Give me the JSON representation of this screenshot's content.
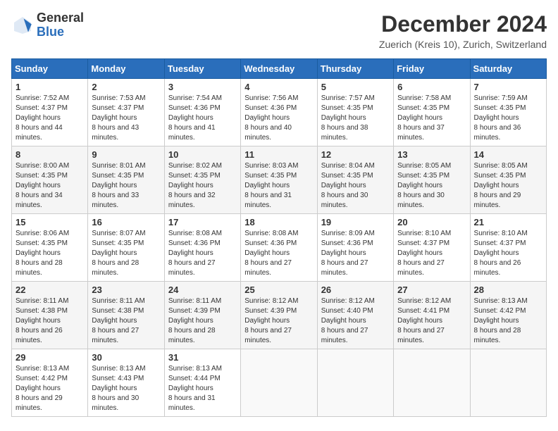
{
  "logo": {
    "general": "General",
    "blue": "Blue"
  },
  "title": "December 2024",
  "subtitle": "Zuerich (Kreis 10), Zurich, Switzerland",
  "weekdays": [
    "Sunday",
    "Monday",
    "Tuesday",
    "Wednesday",
    "Thursday",
    "Friday",
    "Saturday"
  ],
  "weeks": [
    [
      {
        "day": 1,
        "sunrise": "7:52 AM",
        "sunset": "4:37 PM",
        "daylight": "8 hours and 44 minutes."
      },
      {
        "day": 2,
        "sunrise": "7:53 AM",
        "sunset": "4:37 PM",
        "daylight": "8 hours and 43 minutes."
      },
      {
        "day": 3,
        "sunrise": "7:54 AM",
        "sunset": "4:36 PM",
        "daylight": "8 hours and 41 minutes."
      },
      {
        "day": 4,
        "sunrise": "7:56 AM",
        "sunset": "4:36 PM",
        "daylight": "8 hours and 40 minutes."
      },
      {
        "day": 5,
        "sunrise": "7:57 AM",
        "sunset": "4:35 PM",
        "daylight": "8 hours and 38 minutes."
      },
      {
        "day": 6,
        "sunrise": "7:58 AM",
        "sunset": "4:35 PM",
        "daylight": "8 hours and 37 minutes."
      },
      {
        "day": 7,
        "sunrise": "7:59 AM",
        "sunset": "4:35 PM",
        "daylight": "8 hours and 36 minutes."
      }
    ],
    [
      {
        "day": 8,
        "sunrise": "8:00 AM",
        "sunset": "4:35 PM",
        "daylight": "8 hours and 34 minutes."
      },
      {
        "day": 9,
        "sunrise": "8:01 AM",
        "sunset": "4:35 PM",
        "daylight": "8 hours and 33 minutes."
      },
      {
        "day": 10,
        "sunrise": "8:02 AM",
        "sunset": "4:35 PM",
        "daylight": "8 hours and 32 minutes."
      },
      {
        "day": 11,
        "sunrise": "8:03 AM",
        "sunset": "4:35 PM",
        "daylight": "8 hours and 31 minutes."
      },
      {
        "day": 12,
        "sunrise": "8:04 AM",
        "sunset": "4:35 PM",
        "daylight": "8 hours and 30 minutes."
      },
      {
        "day": 13,
        "sunrise": "8:05 AM",
        "sunset": "4:35 PM",
        "daylight": "8 hours and 30 minutes."
      },
      {
        "day": 14,
        "sunrise": "8:05 AM",
        "sunset": "4:35 PM",
        "daylight": "8 hours and 29 minutes."
      }
    ],
    [
      {
        "day": 15,
        "sunrise": "8:06 AM",
        "sunset": "4:35 PM",
        "daylight": "8 hours and 28 minutes."
      },
      {
        "day": 16,
        "sunrise": "8:07 AM",
        "sunset": "4:35 PM",
        "daylight": "8 hours and 28 minutes."
      },
      {
        "day": 17,
        "sunrise": "8:08 AM",
        "sunset": "4:36 PM",
        "daylight": "8 hours and 27 minutes."
      },
      {
        "day": 18,
        "sunrise": "8:08 AM",
        "sunset": "4:36 PM",
        "daylight": "8 hours and 27 minutes."
      },
      {
        "day": 19,
        "sunrise": "8:09 AM",
        "sunset": "4:36 PM",
        "daylight": "8 hours and 27 minutes."
      },
      {
        "day": 20,
        "sunrise": "8:10 AM",
        "sunset": "4:37 PM",
        "daylight": "8 hours and 27 minutes."
      },
      {
        "day": 21,
        "sunrise": "8:10 AM",
        "sunset": "4:37 PM",
        "daylight": "8 hours and 26 minutes."
      }
    ],
    [
      {
        "day": 22,
        "sunrise": "8:11 AM",
        "sunset": "4:38 PM",
        "daylight": "8 hours and 26 minutes."
      },
      {
        "day": 23,
        "sunrise": "8:11 AM",
        "sunset": "4:38 PM",
        "daylight": "8 hours and 27 minutes."
      },
      {
        "day": 24,
        "sunrise": "8:11 AM",
        "sunset": "4:39 PM",
        "daylight": "8 hours and 28 minutes."
      },
      {
        "day": 25,
        "sunrise": "8:12 AM",
        "sunset": "4:39 PM",
        "daylight": "8 hours and 27 minutes."
      },
      {
        "day": 26,
        "sunrise": "8:12 AM",
        "sunset": "4:40 PM",
        "daylight": "8 hours and 27 minutes."
      },
      {
        "day": 27,
        "sunrise": "8:12 AM",
        "sunset": "4:41 PM",
        "daylight": "8 hours and 27 minutes."
      },
      {
        "day": 28,
        "sunrise": "8:13 AM",
        "sunset": "4:42 PM",
        "daylight": "8 hours and 28 minutes."
      }
    ],
    [
      {
        "day": 29,
        "sunrise": "8:13 AM",
        "sunset": "4:42 PM",
        "daylight": "8 hours and 29 minutes."
      },
      {
        "day": 30,
        "sunrise": "8:13 AM",
        "sunset": "4:43 PM",
        "daylight": "8 hours and 30 minutes."
      },
      {
        "day": 31,
        "sunrise": "8:13 AM",
        "sunset": "4:44 PM",
        "daylight": "8 hours and 31 minutes."
      },
      null,
      null,
      null,
      null
    ]
  ]
}
